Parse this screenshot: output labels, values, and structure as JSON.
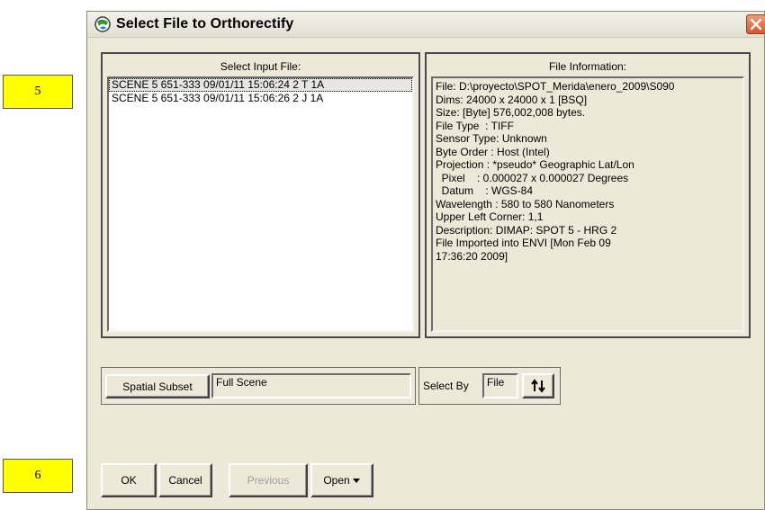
{
  "annotations": {
    "step5": "5",
    "step6": "6"
  },
  "dialog": {
    "title": "Select File to Orthorectify",
    "input_panel": {
      "title": "Select Input File:",
      "files": [
        "SCENE 5 651-333 09/01/11 15:06:24 2 T 1A",
        "SCENE 5 651-333 09/01/11 15:06:26 2 J 1A"
      ],
      "selected_index": 0
    },
    "info_panel": {
      "title": "File Information:",
      "lines": [
        "File: D:\\proyecto\\SPOT_Merida\\enero_2009\\S090",
        "Dims: 24000 x 24000 x 1 [BSQ]",
        "Size: [Byte] 576,002,008 bytes.",
        "File Type  : TIFF",
        "Sensor Type: Unknown",
        "Byte Order : Host (Intel)",
        "Projection : *pseudo* Geographic Lat/Lon",
        "  Pixel    : 0.000027 x 0.000027 Degrees",
        "  Datum    : WGS-84",
        "Wavelength : 580 to 580 Nanometers",
        "Upper Left Corner: 1,1",
        "Description: DIMAP: SPOT 5 - HRG 2",
        "File Imported into ENVI [Mon Feb 09",
        "17:36:20 2009]"
      ]
    },
    "spatial_subset": {
      "button_label": "Spatial Subset",
      "value": "Full Scene"
    },
    "select_by": {
      "label": "Select By",
      "value": "File",
      "icon": "sort-arrows-icon"
    },
    "buttons": {
      "ok": "OK",
      "cancel": "Cancel",
      "previous": "Previous",
      "open": "Open"
    }
  },
  "colors": {
    "dialog_bg": "#ece9d8",
    "annotation_bg": "#ffff00",
    "close_button": "#d8552c"
  }
}
